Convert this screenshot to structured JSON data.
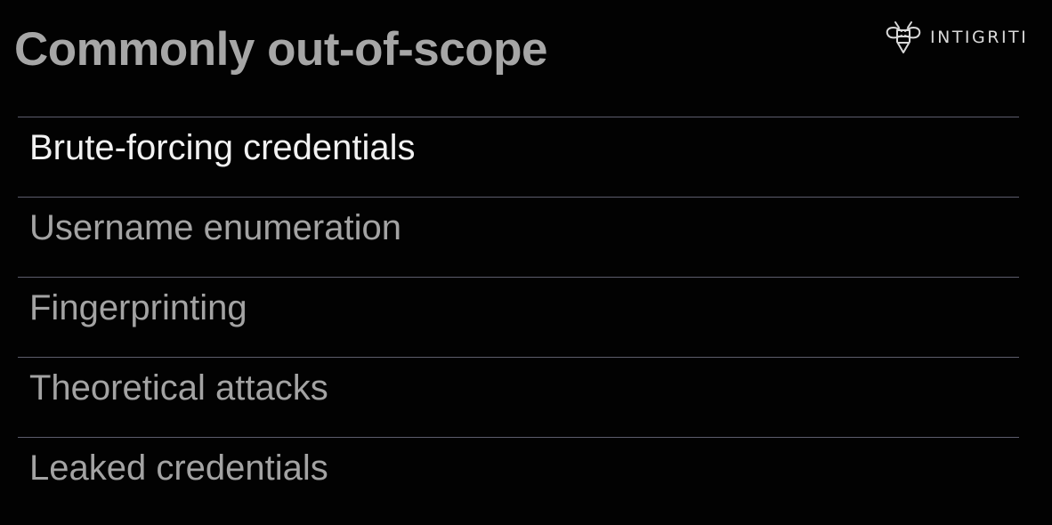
{
  "slide": {
    "title": "Commonly out-of-scope",
    "logo": {
      "icon": "bee-logo-icon",
      "text": "INTIGRITI",
      "color": "#d9d9d9"
    },
    "items": [
      {
        "label": "Brute-forcing credentials",
        "active": true
      },
      {
        "label": "Username enumeration",
        "active": false
      },
      {
        "label": "Fingerprinting",
        "active": false
      },
      {
        "label": "Theoretical attacks",
        "active": false
      },
      {
        "label": "Leaked credentials",
        "active": false
      }
    ],
    "colors": {
      "background": "#020202",
      "title": "#a6a6a6",
      "active_item": "#f2f2f2",
      "inactive_item": "#a3a3a3",
      "divider": "#5c5c6c"
    }
  }
}
